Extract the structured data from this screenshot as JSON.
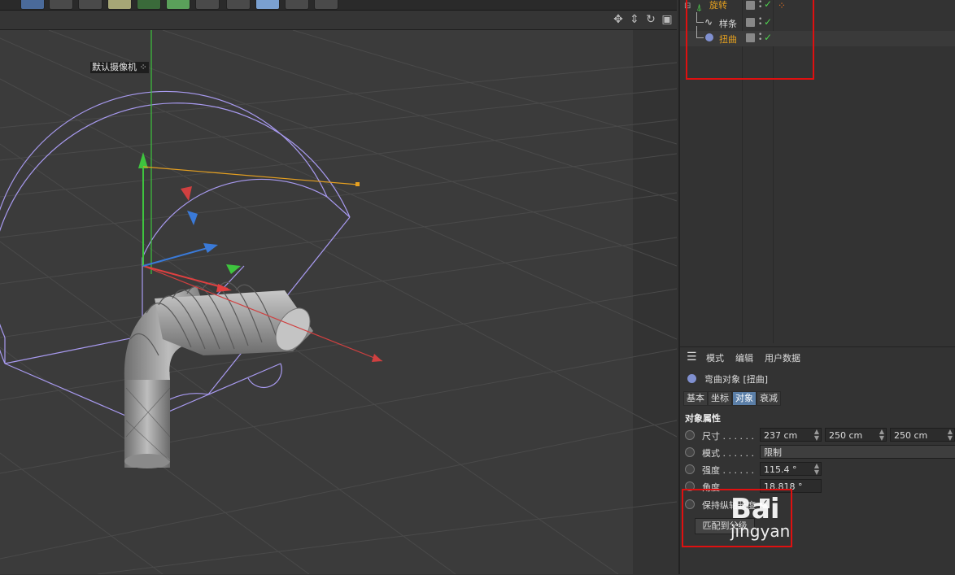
{
  "viewport": {
    "camera_label": "默认摄像机",
    "camera_icon": "camera-dots-icon",
    "nav_icons": [
      "move-icon",
      "zoom-icon",
      "rotate-icon",
      "maximize-icon"
    ]
  },
  "objects": {
    "items": [
      {
        "label": "旋转",
        "icon": "lathe-icon",
        "color": "#e6a11f"
      },
      {
        "label": "样条",
        "icon": "spline-icon",
        "color": "#dddddd"
      },
      {
        "label": "扭曲",
        "icon": "bend-deformer-icon",
        "color": "#e6a11f"
      }
    ]
  },
  "attributes": {
    "menu": [
      "模式",
      "编辑",
      "用户数据"
    ],
    "object_title": "弯曲对象 [扭曲]",
    "tabs": [
      "基本",
      "坐标",
      "对象",
      "衰减"
    ],
    "active_tab": "对象",
    "section_title": "对象属性",
    "size": {
      "label": "尺寸 . . . . . .",
      "x": "237 cm",
      "y": "250 cm",
      "z": "250 cm"
    },
    "mode": {
      "label": "模式 . . . . . .",
      "value": "限制"
    },
    "strength": {
      "label": "强度 . . . . . .",
      "value": "115.4 °"
    },
    "angle": {
      "label": "角度 . . . . . .",
      "value": "18.818 °"
    },
    "keep_length": {
      "label": "保持纵轴长度",
      "checked": true
    },
    "fit_button": "匹配到父级"
  },
  "watermark": {
    "line1": "Bai",
    "line2": "jingyan"
  },
  "colors": {
    "highlight_box": "#e01010",
    "active_tab": "#5b7fa8",
    "check": "#4fd04f"
  }
}
